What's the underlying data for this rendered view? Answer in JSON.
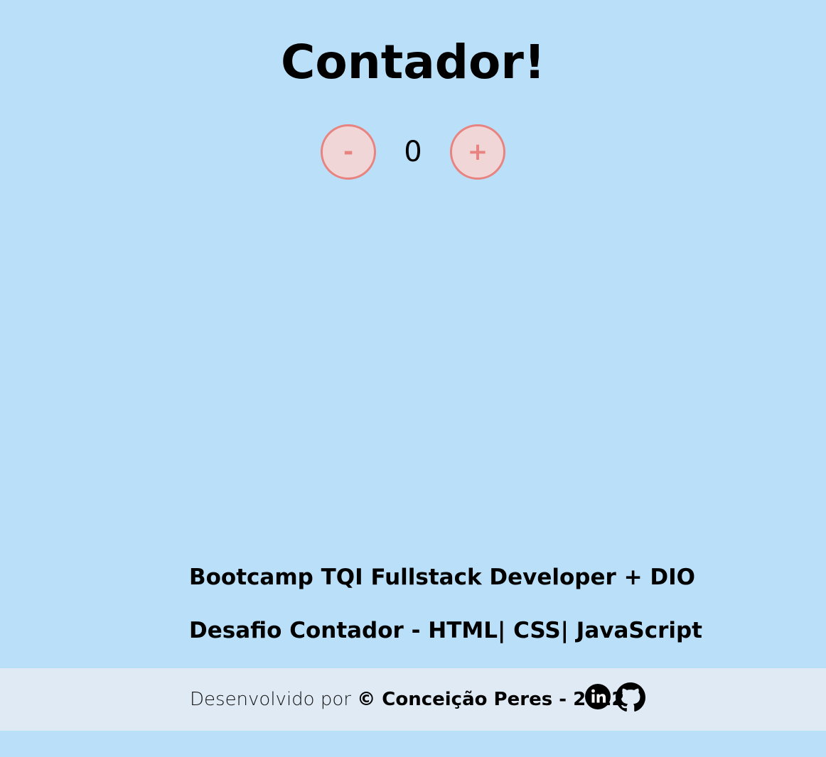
{
  "page": {
    "title": "Contador!"
  },
  "counter": {
    "decrement_label": "-",
    "value": "0",
    "increment_label": "+"
  },
  "info": {
    "line1": "Bootcamp TQI Fullstack Developer + DIO",
    "line2": "Desafio Contador - HTML| CSS| JavaScript"
  },
  "footer": {
    "prefix": "Desenvolvido por ",
    "author": "© Conceição Peres - 2022",
    "social": [
      {
        "icon": "linkedin-icon"
      },
      {
        "icon": "github-icon"
      }
    ]
  },
  "colors": {
    "background": "#bae0f9",
    "footer_background": "#dfeaf4",
    "button_border": "#e8837f",
    "button_fill": "#f1d6d8"
  }
}
